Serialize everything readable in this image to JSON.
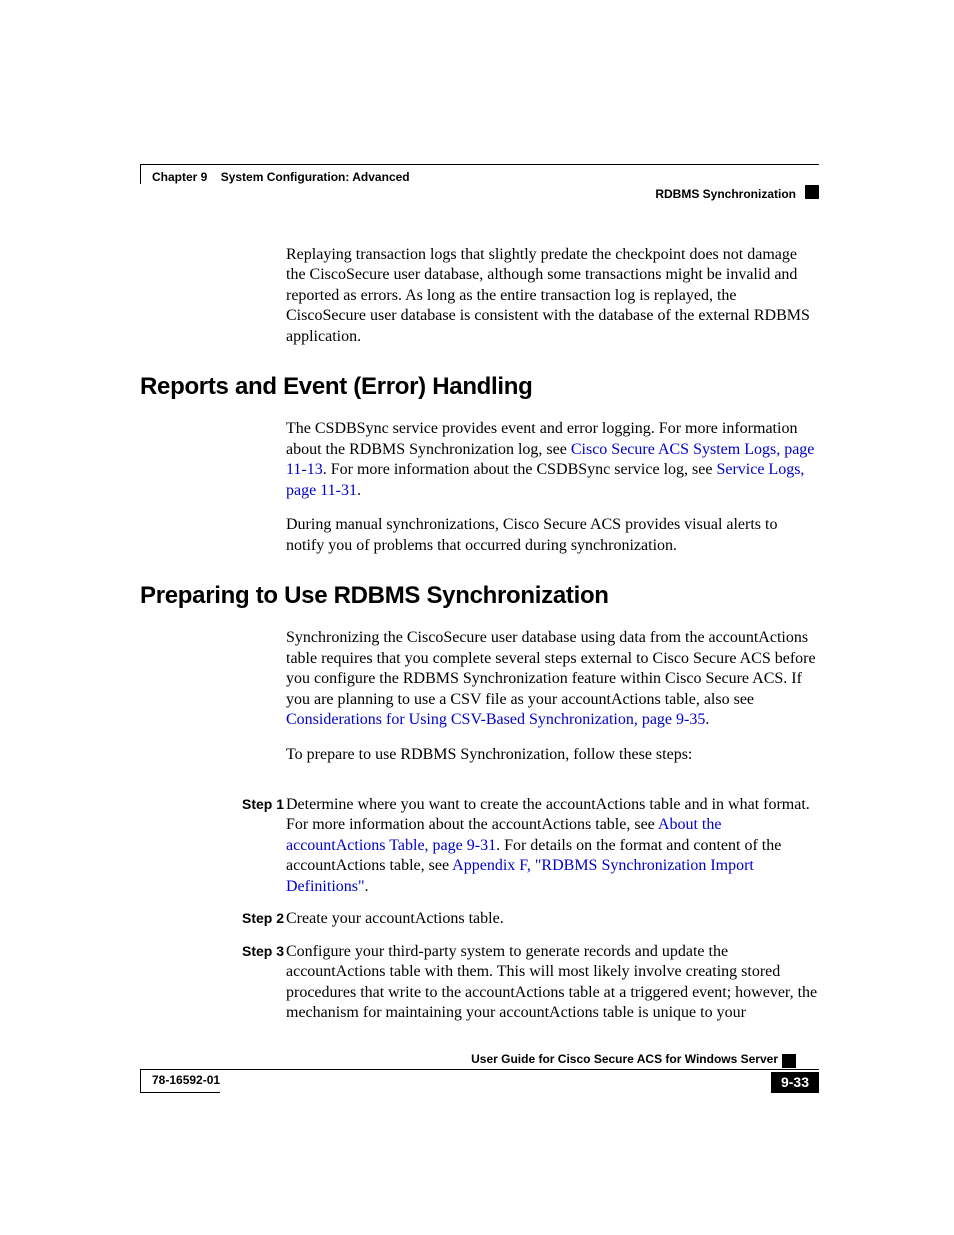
{
  "header": {
    "chapter_label": "Chapter 9",
    "chapter_title": "System Configuration: Advanced",
    "section_title": "RDBMS Synchronization"
  },
  "intro_para": "Replaying transaction logs that slightly predate the checkpoint does not damage the CiscoSecure user database, although some transactions might be invalid and reported as errors. As long as the entire transaction log is replayed, the CiscoSecure user database is consistent with the database of the external RDBMS application.",
  "section_reports": {
    "heading": "Reports and Event (Error) Handling",
    "p1_a": "The CSDBSync service provides event and error logging. For more information about the RDBMS Synchronization log, see ",
    "p1_link1": "Cisco Secure ACS System Logs, page 11-13",
    "p1_b": ". For more information about the CSDBSync service log, see ",
    "p1_link2": "Service Logs, page 11-31",
    "p1_c": ".",
    "p2": "During manual synchronizations, Cisco Secure ACS provides visual alerts to notify you of problems that occurred during synchronization."
  },
  "section_prepare": {
    "heading": "Preparing to Use RDBMS Synchronization",
    "p1_a": "Synchronizing the CiscoSecure user database using data from the accountActions table requires that you complete several steps external to Cisco Secure ACS before you configure the RDBMS Synchronization feature within Cisco Secure ACS. If you are planning to use a CSV file as your accountActions table, also see ",
    "p1_link1": "Considerations for Using CSV-Based Synchronization, page 9-35",
    "p1_b": ".",
    "p2": "To prepare to use RDBMS Synchronization, follow these steps:"
  },
  "steps": [
    {
      "label": "Step 1",
      "t1": "Determine where you want to create the accountActions table and in what format. For more information about the accountActions table, see ",
      "link1": "About the accountActions Table, page 9-31",
      "t2": ". For details on the format and content of the accountActions table, see ",
      "link2": "Appendix F, \"RDBMS Synchronization Import Definitions\"",
      "t3": "."
    },
    {
      "label": "Step 2",
      "t1": "Create your accountActions table.",
      "link1": "",
      "t2": "",
      "link2": "",
      "t3": ""
    },
    {
      "label": "Step 3",
      "t1": "Configure your third-party system to generate records and update the accountActions table with them. This will most likely involve creating stored procedures that write to the accountActions table at a triggered event; however, the mechanism for maintaining your accountActions table is unique to your",
      "link1": "",
      "t2": "",
      "link2": "",
      "t3": ""
    }
  ],
  "footer": {
    "book_title": "User Guide for Cisco Secure ACS for Windows Server",
    "doc_number": "78-16592-01",
    "page_number": "9-33"
  }
}
